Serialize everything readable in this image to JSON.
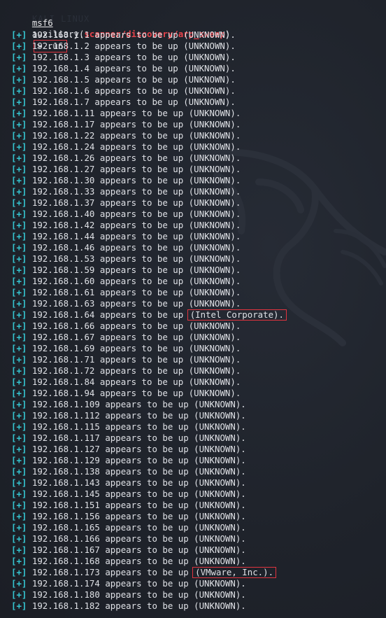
{
  "prompt": {
    "msf": "msf6",
    "word": "auxiliary(",
    "module": "scanner/discovery/arp_sweep",
    "close": ")",
    "arrow": ">",
    "command": "run"
  },
  "watermark_text": "KALI LINUX",
  "colors": {
    "background": "#1d2129",
    "module": "#e8424a",
    "status_plus": "#36c5d0",
    "highlight_box": "#e0343f",
    "text": "#dfe1e6"
  },
  "result_lines": [
    {
      "status": "[+]",
      "ip": "192.168.1.1",
      "text": "appears to be up",
      "vendor": "(UNKNOWN)."
    },
    {
      "status": "[+]",
      "ip": "192.168.1.2",
      "text": "appears to be up",
      "vendor": "(UNKNOWN)."
    },
    {
      "status": "[+]",
      "ip": "192.168.1.3",
      "text": "appears to be up",
      "vendor": "(UNKNOWN)."
    },
    {
      "status": "[+]",
      "ip": "192.168.1.4",
      "text": "appears to be up",
      "vendor": "(UNKNOWN)."
    },
    {
      "status": "[+]",
      "ip": "192.168.1.5",
      "text": "appears to be up",
      "vendor": "(UNKNOWN)."
    },
    {
      "status": "[+]",
      "ip": "192.168.1.6",
      "text": "appears to be up",
      "vendor": "(UNKNOWN)."
    },
    {
      "status": "[+]",
      "ip": "192.168.1.7",
      "text": "appears to be up",
      "vendor": "(UNKNOWN)."
    },
    {
      "status": "[+]",
      "ip": "192.168.1.11",
      "text": "appears to be up",
      "vendor": "(UNKNOWN)."
    },
    {
      "status": "[+]",
      "ip": "192.168.1.17",
      "text": "appears to be up",
      "vendor": "(UNKNOWN)."
    },
    {
      "status": "[+]",
      "ip": "192.168.1.22",
      "text": "appears to be up",
      "vendor": "(UNKNOWN)."
    },
    {
      "status": "[+]",
      "ip": "192.168.1.24",
      "text": "appears to be up",
      "vendor": "(UNKNOWN)."
    },
    {
      "status": "[+]",
      "ip": "192.168.1.26",
      "text": "appears to be up",
      "vendor": "(UNKNOWN)."
    },
    {
      "status": "[+]",
      "ip": "192.168.1.27",
      "text": "appears to be up",
      "vendor": "(UNKNOWN)."
    },
    {
      "status": "[+]",
      "ip": "192.168.1.30",
      "text": "appears to be up",
      "vendor": "(UNKNOWN)."
    },
    {
      "status": "[+]",
      "ip": "192.168.1.33",
      "text": "appears to be up",
      "vendor": "(UNKNOWN)."
    },
    {
      "status": "[+]",
      "ip": "192.168.1.37",
      "text": "appears to be up",
      "vendor": "(UNKNOWN)."
    },
    {
      "status": "[+]",
      "ip": "192.168.1.40",
      "text": "appears to be up",
      "vendor": "(UNKNOWN)."
    },
    {
      "status": "[+]",
      "ip": "192.168.1.42",
      "text": "appears to be up",
      "vendor": "(UNKNOWN)."
    },
    {
      "status": "[+]",
      "ip": "192.168.1.44",
      "text": "appears to be up",
      "vendor": "(UNKNOWN)."
    },
    {
      "status": "[+]",
      "ip": "192.168.1.46",
      "text": "appears to be up",
      "vendor": "(UNKNOWN)."
    },
    {
      "status": "[+]",
      "ip": "192.168.1.53",
      "text": "appears to be up",
      "vendor": "(UNKNOWN)."
    },
    {
      "status": "[+]",
      "ip": "192.168.1.59",
      "text": "appears to be up",
      "vendor": "(UNKNOWN)."
    },
    {
      "status": "[+]",
      "ip": "192.168.1.60",
      "text": "appears to be up",
      "vendor": "(UNKNOWN)."
    },
    {
      "status": "[+]",
      "ip": "192.168.1.61",
      "text": "appears to be up",
      "vendor": "(UNKNOWN)."
    },
    {
      "status": "[+]",
      "ip": "192.168.1.63",
      "text": "appears to be up",
      "vendor": "(UNKNOWN)."
    },
    {
      "status": "[+]",
      "ip": "192.168.1.64",
      "text": "appears to be up",
      "vendor": "(Intel Corporate).",
      "highlight": true
    },
    {
      "status": "[+]",
      "ip": "192.168.1.66",
      "text": "appears to be up",
      "vendor": "(UNKNOWN)."
    },
    {
      "status": "[+]",
      "ip": "192.168.1.67",
      "text": "appears to be up",
      "vendor": "(UNKNOWN)."
    },
    {
      "status": "[+]",
      "ip": "192.168.1.69",
      "text": "appears to be up",
      "vendor": "(UNKNOWN)."
    },
    {
      "status": "[+]",
      "ip": "192.168.1.71",
      "text": "appears to be up",
      "vendor": "(UNKNOWN)."
    },
    {
      "status": "[+]",
      "ip": "192.168.1.72",
      "text": "appears to be up",
      "vendor": "(UNKNOWN)."
    },
    {
      "status": "[+]",
      "ip": "192.168.1.84",
      "text": "appears to be up",
      "vendor": "(UNKNOWN)."
    },
    {
      "status": "[+]",
      "ip": "192.168.1.94",
      "text": "appears to be up",
      "vendor": "(UNKNOWN)."
    },
    {
      "status": "[+]",
      "ip": "192.168.1.109",
      "text": "appears to be up",
      "vendor": "(UNKNOWN)."
    },
    {
      "status": "[+]",
      "ip": "192.168.1.112",
      "text": "appears to be up",
      "vendor": "(UNKNOWN)."
    },
    {
      "status": "[+]",
      "ip": "192.168.1.115",
      "text": "appears to be up",
      "vendor": "(UNKNOWN)."
    },
    {
      "status": "[+]",
      "ip": "192.168.1.117",
      "text": "appears to be up",
      "vendor": "(UNKNOWN)."
    },
    {
      "status": "[+]",
      "ip": "192.168.1.127",
      "text": "appears to be up",
      "vendor": "(UNKNOWN)."
    },
    {
      "status": "[+]",
      "ip": "192.168.1.129",
      "text": "appears to be up",
      "vendor": "(UNKNOWN)."
    },
    {
      "status": "[+]",
      "ip": "192.168.1.138",
      "text": "appears to be up",
      "vendor": "(UNKNOWN)."
    },
    {
      "status": "[+]",
      "ip": "192.168.1.143",
      "text": "appears to be up",
      "vendor": "(UNKNOWN)."
    },
    {
      "status": "[+]",
      "ip": "192.168.1.145",
      "text": "appears to be up",
      "vendor": "(UNKNOWN)."
    },
    {
      "status": "[+]",
      "ip": "192.168.1.151",
      "text": "appears to be up",
      "vendor": "(UNKNOWN)."
    },
    {
      "status": "[+]",
      "ip": "192.168.1.156",
      "text": "appears to be up",
      "vendor": "(UNKNOWN)."
    },
    {
      "status": "[+]",
      "ip": "192.168.1.165",
      "text": "appears to be up",
      "vendor": "(UNKNOWN)."
    },
    {
      "status": "[+]",
      "ip": "192.168.1.166",
      "text": "appears to be up",
      "vendor": "(UNKNOWN)."
    },
    {
      "status": "[+]",
      "ip": "192.168.1.167",
      "text": "appears to be up",
      "vendor": "(UNKNOWN)."
    },
    {
      "status": "[+]",
      "ip": "192.168.1.168",
      "text": "appears to be up",
      "vendor": "(UNKNOWN)."
    },
    {
      "status": "[+]",
      "ip": "192.168.1.173",
      "text": "appears to be up",
      "vendor": "(VMware, Inc.).",
      "highlight": true
    },
    {
      "status": "[+]",
      "ip": "192.168.1.174",
      "text": "appears to be up",
      "vendor": "(UNKNOWN)."
    },
    {
      "status": "[+]",
      "ip": "192.168.1.180",
      "text": "appears to be up",
      "vendor": "(UNKNOWN)."
    },
    {
      "status": "[+]",
      "ip": "192.168.1.182",
      "text": "appears to be up",
      "vendor": "(UNKNOWN)."
    }
  ]
}
